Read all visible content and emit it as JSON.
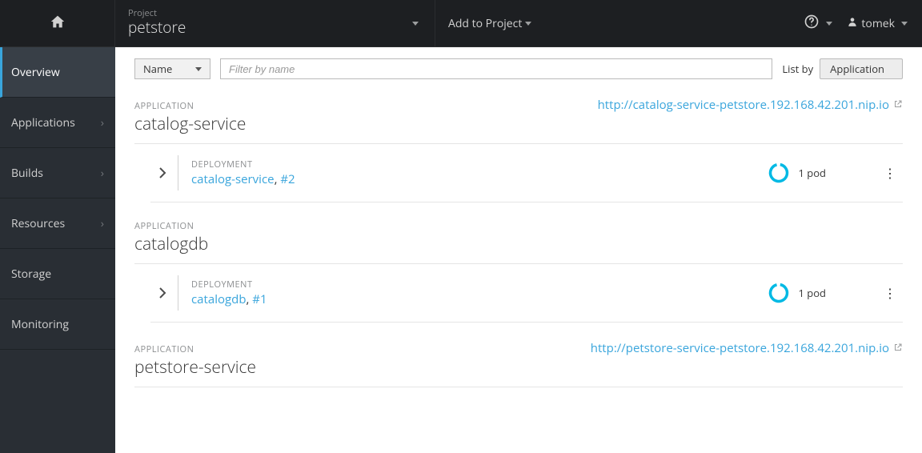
{
  "header": {
    "project_label": "Project",
    "project_name": "petstore",
    "add_to_project": "Add to Project",
    "username": "tomek"
  },
  "sidebar": {
    "items": [
      {
        "label": "Overview",
        "has_sub": false,
        "active": true
      },
      {
        "label": "Applications",
        "has_sub": true,
        "active": false
      },
      {
        "label": "Builds",
        "has_sub": true,
        "active": false
      },
      {
        "label": "Resources",
        "has_sub": true,
        "active": false
      },
      {
        "label": "Storage",
        "has_sub": false,
        "active": false
      },
      {
        "label": "Monitoring",
        "has_sub": false,
        "active": false
      }
    ]
  },
  "toolbar": {
    "filter_field_label": "Name",
    "filter_placeholder": "Filter by name",
    "list_by_label": "List by",
    "list_by_value": "Application"
  },
  "apps": [
    {
      "section": "APPLICATION",
      "name": "catalog-service",
      "route": "http://catalog-service-petstore.192.168.42.201.nip.io",
      "deployment": {
        "label": "DEPLOYMENT",
        "name": "catalog-service",
        "rev": "#2",
        "pods": "1 pod"
      }
    },
    {
      "section": "APPLICATION",
      "name": "catalogdb",
      "route": "",
      "deployment": {
        "label": "DEPLOYMENT",
        "name": "catalogdb",
        "rev": "#1",
        "pods": "1 pod"
      }
    },
    {
      "section": "APPLICATION",
      "name": "petstore-service",
      "route": "http://petstore-service-petstore.192.168.42.201.nip.io",
      "deployment": null
    }
  ]
}
